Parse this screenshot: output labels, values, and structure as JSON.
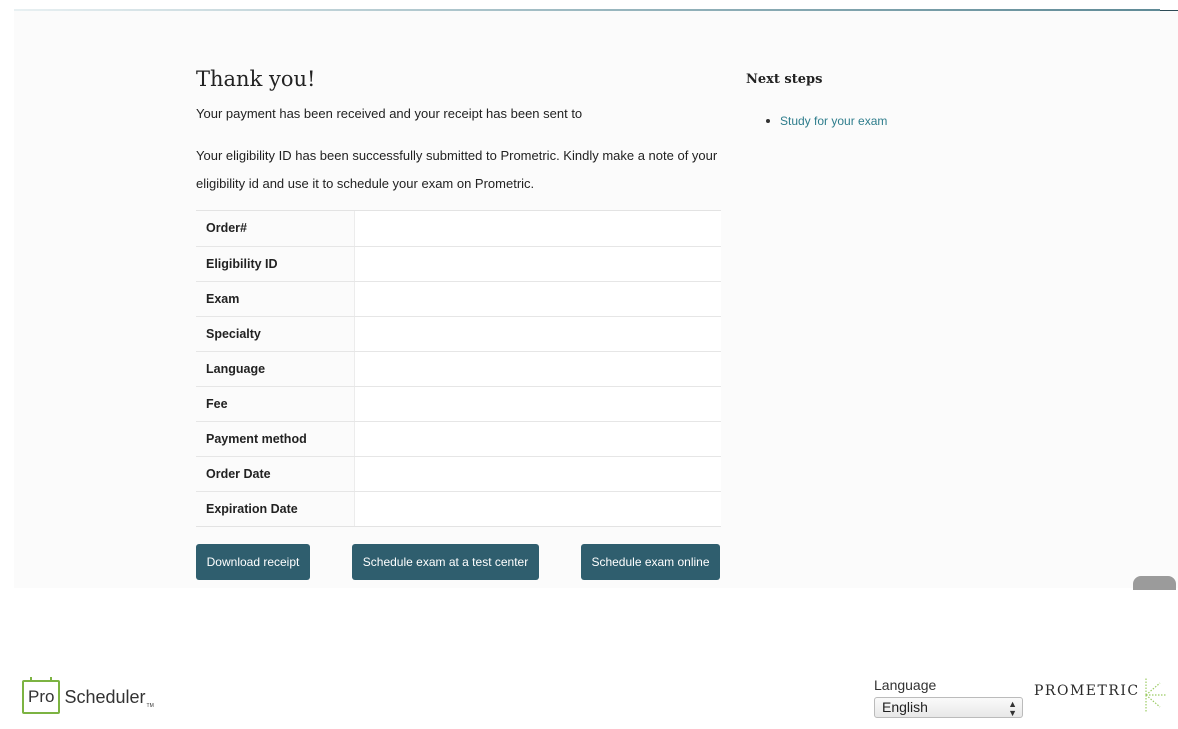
{
  "page": {
    "title": "Thank you!",
    "payment_text": "Your payment has been received and your receipt has been sent to",
    "eligibility_text": "Your eligibility ID has been successfully submitted to Prometric. Kindly make a note of your eligibility id and use it to schedule your exam on Prometric."
  },
  "details": {
    "rows": [
      {
        "label": "Order#",
        "value": ""
      },
      {
        "label": "Eligibility ID",
        "value": ""
      },
      {
        "label": "Exam",
        "value": ""
      },
      {
        "label": "Specialty",
        "value": ""
      },
      {
        "label": "Language",
        "value": ""
      },
      {
        "label": "Fee",
        "value": ""
      },
      {
        "label": "Payment method",
        "value": ""
      },
      {
        "label": "Order Date",
        "value": ""
      },
      {
        "label": "Expiration Date",
        "value": ""
      }
    ]
  },
  "buttons": {
    "download": "Download receipt",
    "test_center": "Schedule exam at a test center",
    "online": "Schedule exam online"
  },
  "next_steps": {
    "title": "Next steps",
    "items": [
      "Study for your exam"
    ]
  },
  "footer": {
    "logo_pro": "Pro",
    "logo_scheduler": "Scheduler",
    "logo_tm": "TM",
    "language_label": "Language",
    "language_value": "English",
    "brand": "PROMETRIC"
  },
  "colors": {
    "button": "#2f5e6e",
    "link": "#2e7d8c",
    "logo_green": "#7cb342"
  },
  "icons": {
    "accessibility": "accessibility-icon",
    "select_arrows": "updown-arrows-icon"
  }
}
